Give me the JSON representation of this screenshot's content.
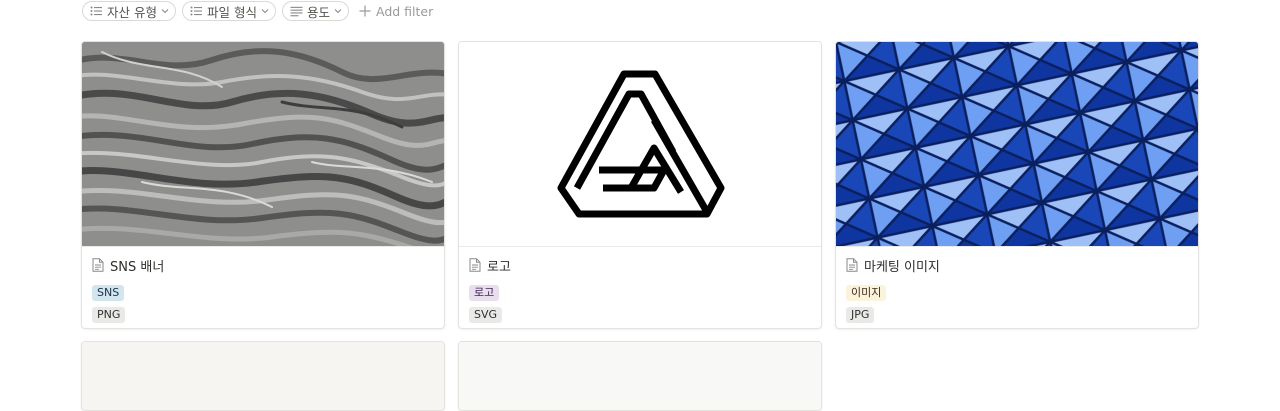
{
  "filters": [
    {
      "label": "자산 유형",
      "icon": "list-icon"
    },
    {
      "label": "파일 형식",
      "icon": "list-icon"
    },
    {
      "label": "용도",
      "icon": "lines-icon"
    }
  ],
  "add_filter_label": "Add filter",
  "cards": [
    {
      "title": "SNS 배너",
      "cover": "marble-texture-image",
      "tag1": {
        "label": "SNS",
        "bg": "#d3e5ef",
        "color": "#183347"
      },
      "tag2": {
        "label": "PNG",
        "bg": "#e9e9e7",
        "color": "#32302c"
      }
    },
    {
      "title": "로고",
      "cover": "impossible-triangle-logo",
      "tag1": {
        "label": "로고",
        "bg": "#e8deee",
        "color": "#412454"
      },
      "tag2": {
        "label": "SVG",
        "bg": "#e9e9e7",
        "color": "#32302c"
      }
    },
    {
      "title": "마케팅 이미지",
      "cover": "blue-geometric-facade-image",
      "tag1": {
        "label": "이미지",
        "bg": "#fbf3db",
        "color": "#402c1b"
      },
      "tag2": {
        "label": "JPG",
        "bg": "#e9e9e7",
        "color": "#32302c"
      }
    }
  ],
  "colors": {
    "text": "#37352f",
    "muted": "#9b9a97",
    "card_border": "#e3e2de",
    "card4_cover": "#f6f5f1",
    "card5_cover": "#f8f8f7"
  }
}
